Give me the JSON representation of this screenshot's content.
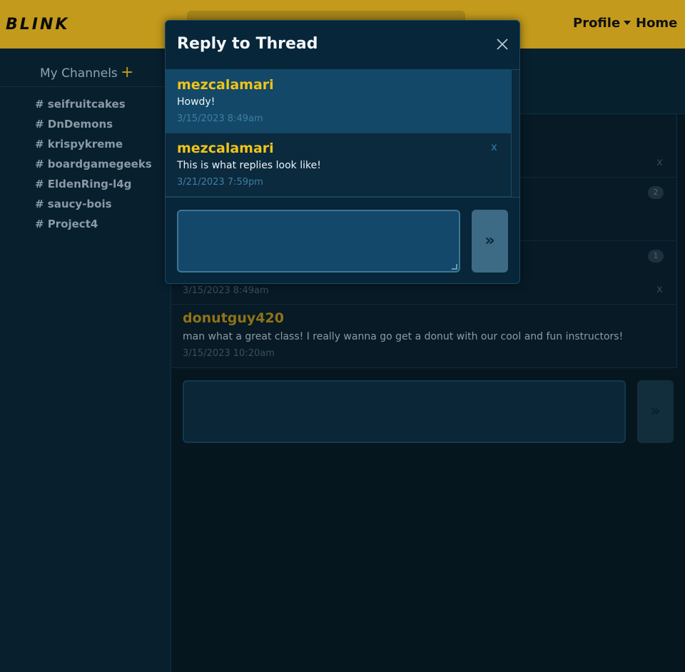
{
  "navbar": {
    "brand": "BLINK",
    "profile_label": "Profile",
    "home_label": "Home"
  },
  "sidebar": {
    "title": "My Channels",
    "add_icon": "+",
    "channels": [
      "# seifruitcakes",
      "# DnDemons",
      "# krispykreme",
      "# boardgamegeeks",
      "# EldenRing-l4g",
      "# saucy-bois",
      "# Project4"
    ]
  },
  "main": {
    "messages": [
      {
        "author": "",
        "text": "",
        "time": "",
        "x": "x",
        "badge": ""
      },
      {
        "author": "",
        "text": "",
        "time": "",
        "x": "",
        "badge": "2"
      },
      {
        "author": "",
        "text": "",
        "time": "3/15/2023 8:49am",
        "x": "x",
        "badge": "1"
      },
      {
        "author": "donutguy420",
        "text": "man what a great class! I really wanna go get a donut with our cool and fun instructors!",
        "time": "3/15/2023 10:20am",
        "x": "",
        "badge": ""
      }
    ],
    "send_label": "»"
  },
  "modal": {
    "title": "Reply to Thread",
    "close_icon": "close-icon",
    "replies": [
      {
        "author": "mezcalamari",
        "text": "Howdy!",
        "time": "3/15/2023 8:49am",
        "x": ""
      },
      {
        "author": "mezcalamari",
        "text": "This is what replies look like!",
        "time": "3/21/2023 7:59pm",
        "x": "x"
      }
    ],
    "input_value": "",
    "send_label": "»"
  },
  "colors": {
    "navbar": "#c39a1c",
    "author": "#f0c419",
    "background": "#071e2c"
  }
}
